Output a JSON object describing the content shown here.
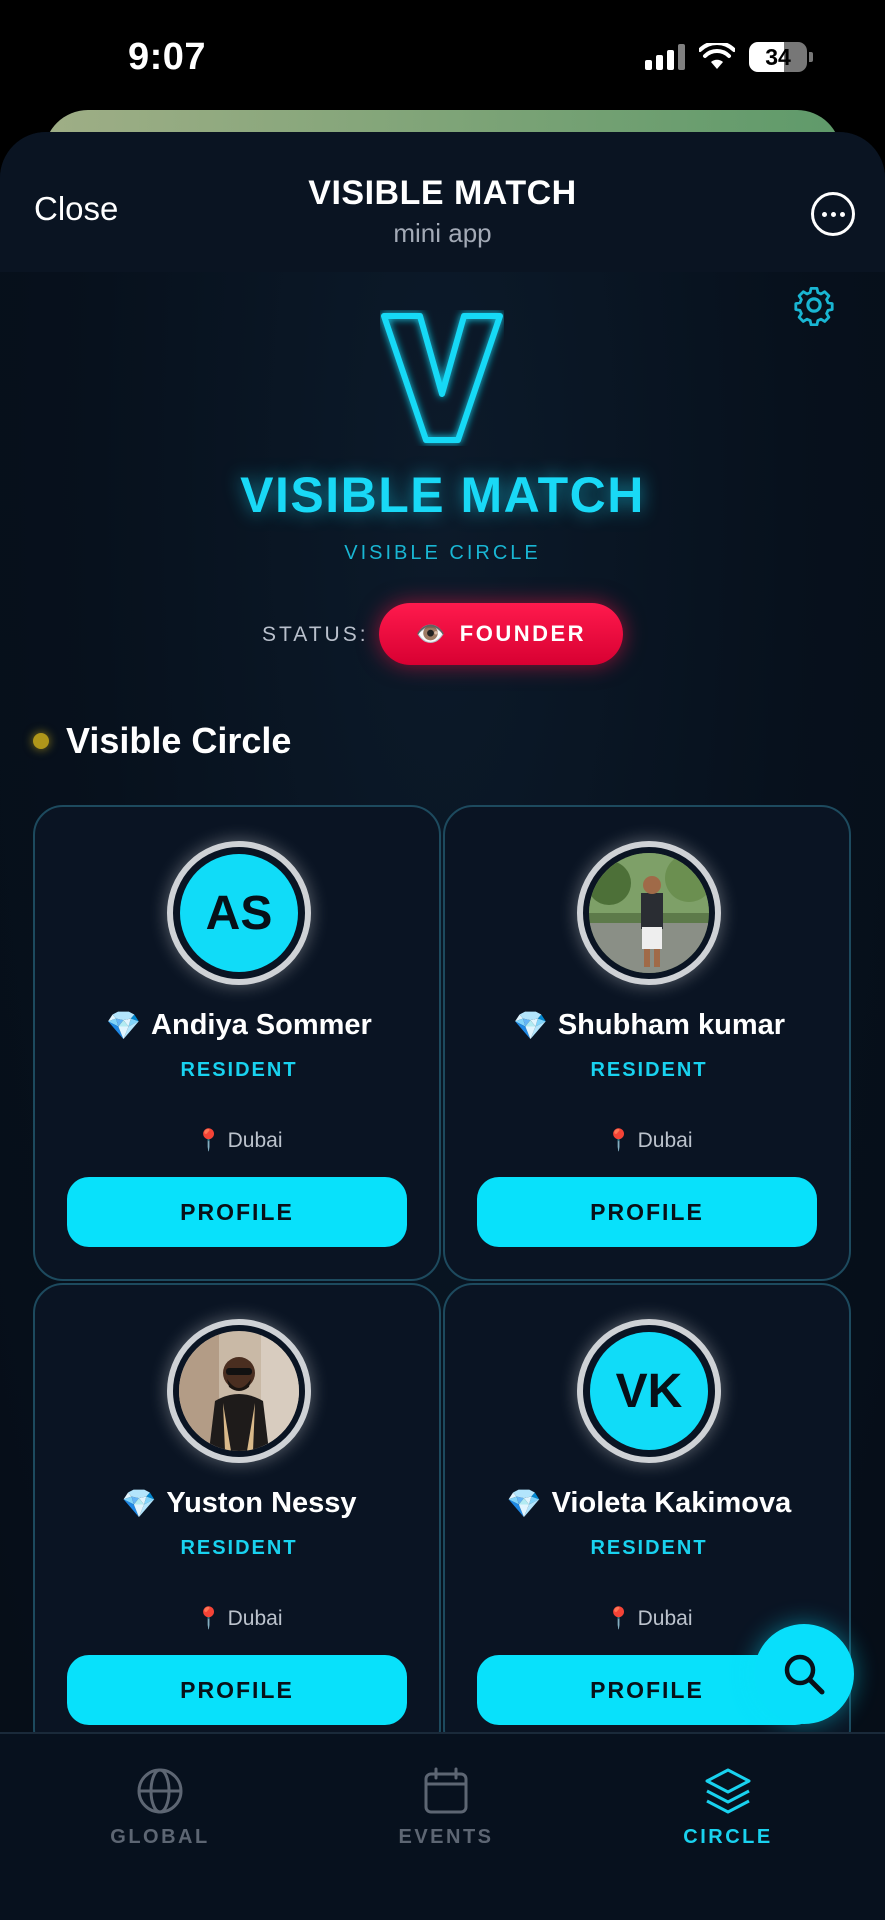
{
  "status_bar": {
    "time": "9:07",
    "battery": "34"
  },
  "header": {
    "close_label": "Close",
    "title": "VISIBLE MATCH",
    "subtitle": "mini app"
  },
  "brand": {
    "logo_letter": "V",
    "title": "VISIBLE MATCH",
    "subtitle": "VISIBLE CIRCLE"
  },
  "status": {
    "label": "STATUS:",
    "badge_icon": "👁️",
    "badge_text": "FOUNDER"
  },
  "section": {
    "title": "Visible Circle"
  },
  "members": [
    {
      "name": "Andiya Sommer",
      "initials": "AS",
      "role": "RESIDENT",
      "location": "Dubai",
      "button": "PROFILE",
      "has_photo": false
    },
    {
      "name": "Shubham kumar",
      "initials": "",
      "role": "RESIDENT",
      "location": "Dubai",
      "button": "PROFILE",
      "has_photo": true
    },
    {
      "name": "Yuston Nessy",
      "initials": "",
      "role": "RESIDENT",
      "location": "Dubai",
      "button": "PROFILE",
      "has_photo": true
    },
    {
      "name": "Violeta Kakimova",
      "initials": "VK",
      "role": "RESIDENT",
      "location": "Dubai",
      "button": "PROFILE",
      "has_photo": false
    }
  ],
  "nav": {
    "items": [
      {
        "label": "GLOBAL",
        "icon": "globe-icon",
        "active": false
      },
      {
        "label": "EVENTS",
        "icon": "calendar-icon",
        "active": false
      },
      {
        "label": "CIRCLE",
        "icon": "layers-icon",
        "active": true
      }
    ]
  },
  "colors": {
    "accent": "#19d9f6",
    "founder": "#ff1a4d",
    "background": "#07111d"
  }
}
